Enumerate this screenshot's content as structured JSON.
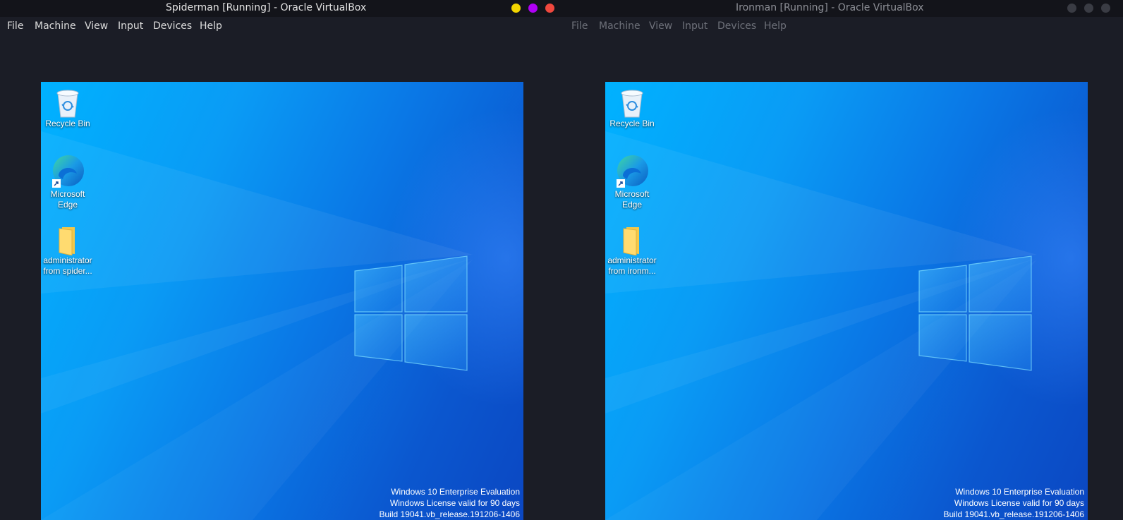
{
  "windows": [
    {
      "title": "Spiderman [Running] - Oracle VirtualBox",
      "focused": true,
      "menu": [
        "File",
        "Machine",
        "View",
        "Input",
        "Devices",
        "Help"
      ],
      "controls": {
        "minimize_color": "#f2d500",
        "maximize_color": "#b000f5",
        "close_color": "#f0483e"
      },
      "desktop": {
        "icons": [
          {
            "label": "Recycle Bin",
            "icon": "recycle-bin-icon"
          },
          {
            "label_lines": [
              "Microsoft",
              "Edge"
            ],
            "icon": "edge-icon"
          },
          {
            "label_lines": [
              "administrator",
              "from spider..."
            ],
            "icon": "folder-icon"
          }
        ],
        "watermark": [
          "Windows 10 Enterprise Evaluation",
          "Windows License valid for 90 days",
          "Build 19041.vb_release.191206-1406"
        ]
      }
    },
    {
      "title": "Ironman [Running] - Oracle VirtualBox",
      "focused": false,
      "menu": [
        "File",
        "Machine",
        "View",
        "Input",
        "Devices",
        "Help"
      ],
      "controls": {
        "minimize_color": "#3a3c44",
        "maximize_color": "#3a3c44",
        "close_color": "#3a3c44"
      },
      "desktop": {
        "icons": [
          {
            "label": "Recycle Bin",
            "icon": "recycle-bin-icon"
          },
          {
            "label_lines": [
              "Microsoft",
              "Edge"
            ],
            "icon": "edge-icon"
          },
          {
            "label_lines": [
              "administrator",
              "from ironm..."
            ],
            "icon": "folder-icon"
          }
        ],
        "watermark": [
          "Windows 10 Enterprise Evaluation",
          "Windows License valid for 90 days",
          "Build 19041.vb_release.191206-1406"
        ]
      }
    }
  ],
  "colors": {
    "desktop_background": "#1b1d26",
    "titlebar": "#13141a",
    "wallpaper_light": "#00b2ff",
    "wallpaper_dark": "#0b47c2"
  }
}
